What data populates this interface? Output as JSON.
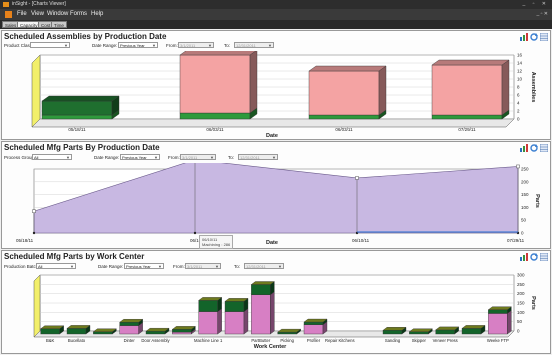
{
  "window": {
    "title": "inSight - [Charts Viewer]",
    "controls": "_ ▫ ✕"
  },
  "menu": {
    "items": [
      "File",
      "View",
      "Window",
      "Forms",
      "Help"
    ],
    "mdi_controls": "_ ▫ ✕"
  },
  "tabs": [
    "Sales",
    "Capacity",
    "Cost",
    "Time"
  ],
  "colors": {
    "pink": "#f4a3a3",
    "green": "#2e9a3c",
    "olive": "#6e7a1e",
    "lavender": "#c8b8e2",
    "magenta": "#d77fc4"
  },
  "panel1": {
    "title": "Scheduled Assemblies by Production Date",
    "filter_label": "Product Class:",
    "filter_value": "",
    "range_label": "Date Range:",
    "range_value": "Previous Year",
    "from_label": "From:",
    "from_value": "3/1/2011",
    "to_label": "To:",
    "to_value": "12/31/2011",
    "xlabel": "Date",
    "ylabel": "Assemblies",
    "icons": [
      "chart-icon",
      "refresh-icon",
      "grid-icon"
    ]
  },
  "panel2": {
    "title": "Scheduled Mfg Parts By Production Date",
    "filter_label": "Process Group:",
    "filter_value": "All",
    "range_label": "Date Range:",
    "range_value": "Previous Year",
    "from_label": "From:",
    "from_value": "3/1/2011",
    "to_label": "To:",
    "to_value": "12/31/2011",
    "xlabel": "Date",
    "ylabel": "Parts",
    "tooltip_line1": "06/10/11",
    "tooltip_line2": "Machining : 286",
    "icons": [
      "chart-icon",
      "refresh-icon",
      "grid-icon"
    ]
  },
  "panel3": {
    "title": "Scheduled Mfg Parts by Work Center",
    "filter_label": "Production Batch:",
    "filter_value": "All",
    "range_label": "Date Range:",
    "range_value": "Previous Year",
    "from_label": "From:",
    "from_value": "3/1/2011",
    "to_label": "To:",
    "to_value": "12/31/2011",
    "xlabel": "Work Center",
    "ylabel": "Parts",
    "icons": [
      "chart-icon",
      "refresh-icon",
      "grid-icon"
    ]
  },
  "chart_data": [
    {
      "type": "bar",
      "title": "Scheduled Assemblies by Production Date",
      "xlabel": "Date",
      "ylabel": "Assemblies",
      "ylim": [
        0,
        16
      ],
      "yticks": [
        0,
        2,
        4,
        6,
        8,
        10,
        12,
        14,
        16
      ],
      "categories": [
        "05/18/11",
        "06/03/11",
        "06/03/11",
        "07/29/11"
      ],
      "series": [
        {
          "values": [
            1,
            1.5,
            1,
            1
          ]
        },
        {
          "values": [
            3.5,
            14.5,
            11,
            12.5
          ]
        }
      ]
    },
    {
      "type": "area",
      "title": "Scheduled Mfg Parts By Production Date",
      "xlabel": "Date",
      "ylabel": "Parts",
      "ylim": [
        0,
        250
      ],
      "yticks": [
        0,
        50,
        100,
        150,
        200,
        250
      ],
      "x": [
        "05/18/11",
        "06/10/11",
        "06/10/11",
        "07/29/11"
      ],
      "series": [
        {
          "name": "Machining",
          "values": [
            85,
            286,
            215,
            260
          ]
        }
      ]
    },
    {
      "type": "bar",
      "title": "Scheduled Mfg Parts by Work Center",
      "xlabel": "Work Center",
      "ylabel": "Parts",
      "ylim": [
        0,
        300
      ],
      "yticks": [
        0,
        50,
        100,
        150,
        200,
        250,
        300
      ],
      "categories": [
        "B&K",
        "Bucellato",
        "",
        "Dinter",
        "Door Assembly",
        "",
        "Machine Line 1",
        "",
        "PartButter",
        "Picking",
        "Profiler",
        "Repair Kitchens",
        "",
        "Sanding",
        "Skipper",
        "Veneer Press",
        "",
        "Weeke FTP"
      ],
      "series": [
        {
          "values": [
            0,
            0,
            0,
            45,
            0,
            10,
            120,
            120,
            210,
            0,
            50,
            0,
            0,
            0,
            0,
            0,
            0,
            110
          ]
        },
        {
          "values": [
            28,
            30,
            12,
            18,
            15,
            15,
            60,
            55,
            55,
            10,
            14,
            0,
            0,
            20,
            12,
            22,
            30,
            20
          ]
        }
      ]
    }
  ]
}
